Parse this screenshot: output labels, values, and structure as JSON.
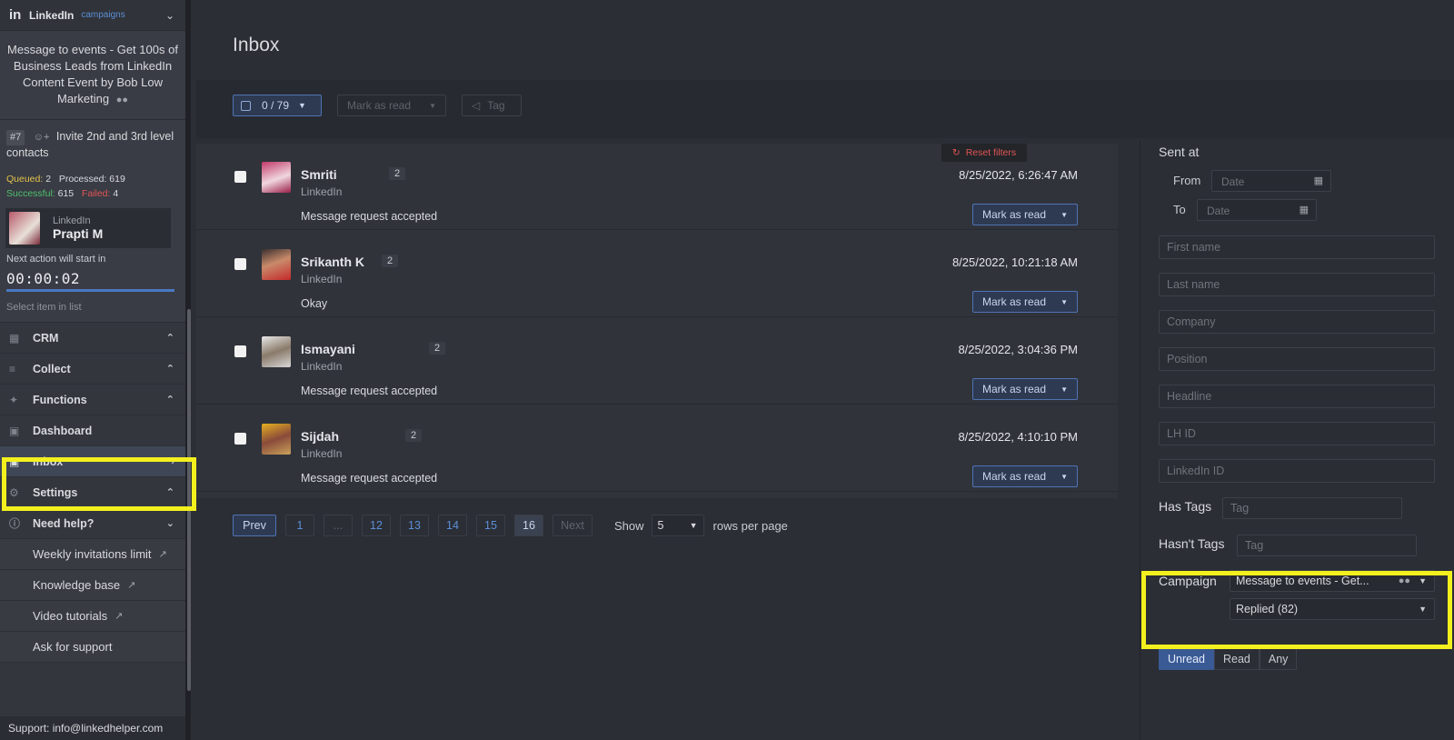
{
  "sidebar": {
    "app_name": "LinkedIn",
    "app_sub": "campaigns",
    "campaign_title": "Message to events - Get 100s of Business Leads from LinkedIn Content Event by Bob Low Marketing",
    "step_num": "#7",
    "step_label": "Invite 2nd and 3rd level contacts",
    "stats": {
      "queued_label": "Queued:",
      "queued": "2",
      "processed_label": "Processed:",
      "processed": "619",
      "successful_label": "Successful:",
      "successful": "615",
      "failed_label": "Failed:",
      "failed": "4"
    },
    "profile": {
      "network": "LinkedIn",
      "name": "Prapti M"
    },
    "next_action": "Next action will start in",
    "timer": "00:00:02",
    "select_hint": "Select item in list",
    "nav": [
      {
        "label": "CRM",
        "icon": "grid-icon"
      },
      {
        "label": "Collect",
        "icon": "list-add-icon"
      },
      {
        "label": "Functions",
        "icon": "puzzle-icon"
      },
      {
        "label": "Dashboard",
        "icon": "dashboard-icon"
      },
      {
        "label": "Inbox",
        "icon": "inbox-icon"
      },
      {
        "label": "Settings",
        "icon": "gear-icon"
      },
      {
        "label": "Need help?",
        "icon": "help-icon"
      }
    ],
    "help_items": [
      "Weekly invitations limit",
      "Knowledge base",
      "Video tutorials",
      "Ask for support"
    ],
    "support": "Support: info@linkedhelper.com"
  },
  "main": {
    "title": "Inbox",
    "toolbar": {
      "select_count": "0 / 79",
      "mark_as_read": "Mark as read",
      "tag": "Tag"
    },
    "reset_filters": "Reset filters",
    "messages": [
      {
        "name": "Smriti",
        "count": "2",
        "network": "LinkedIn",
        "text": "Message request accepted",
        "date": "8/25/2022, 6:26:47 AM",
        "button": "Mark as read"
      },
      {
        "name": "Srikanth K",
        "count": "2",
        "network": "LinkedIn",
        "text": "Okay",
        "date": "8/25/2022, 10:21:18 AM",
        "button": "Mark as read"
      },
      {
        "name": "Ismayani",
        "count": "2",
        "network": "LinkedIn",
        "text": "Message request accepted",
        "date": "8/25/2022, 3:04:36 PM",
        "button": "Mark as read"
      },
      {
        "name": "Sijdah",
        "count": "2",
        "network": "LinkedIn",
        "text": "Message request accepted",
        "date": "8/25/2022, 4:10:10 PM",
        "button": "Mark as read"
      }
    ],
    "pager": {
      "prev": "Prev",
      "pages": [
        "1",
        "...",
        "12",
        "13",
        "14",
        "15",
        "16"
      ],
      "next": "Next",
      "show_label": "Show",
      "rows_value": "5",
      "rows_label": "rows per page"
    }
  },
  "filters": {
    "sent_at": "Sent at",
    "from_label": "From",
    "to_label": "To",
    "date_placeholder": "Date",
    "fields": [
      "First name",
      "Last name",
      "Company",
      "Position",
      "Headline",
      "LH ID",
      "LinkedIn ID"
    ],
    "has_tags_label": "Has Tags",
    "hasnt_tags_label": "Hasn't Tags",
    "tag_placeholder": "Tag",
    "campaign_label": "Campaign",
    "campaign_value": "Message to events - Get...",
    "status_value": "Replied (82)",
    "read_filter": [
      "Unread",
      "Read",
      "Any"
    ],
    "read_filter_selected": "Unread"
  },
  "colors": {
    "accent": "#4f73b4",
    "highlight": "#f3f01e",
    "queued": "#e4c24b",
    "success": "#4fbf6c",
    "failed": "#e25555"
  }
}
